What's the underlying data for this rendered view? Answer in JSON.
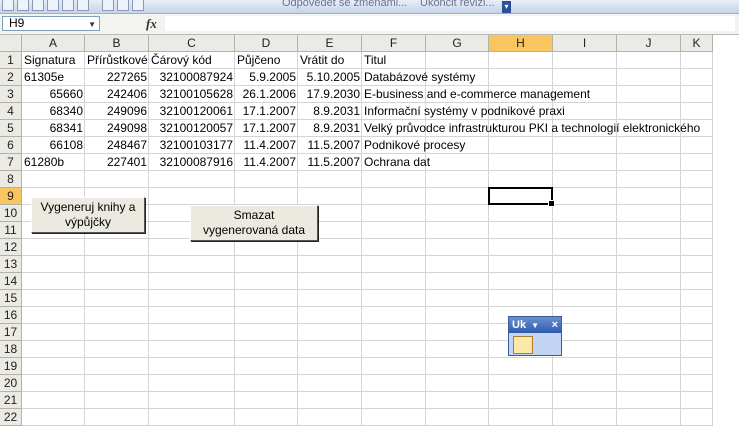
{
  "toolbar": {
    "reply_changes": "Odpovědět se změnami...",
    "end_review": "Ukončit revizi..."
  },
  "formula_bar": {
    "name_box": "H9",
    "fx": "fx",
    "formula": ""
  },
  "columns": [
    "A",
    "B",
    "C",
    "D",
    "E",
    "F",
    "G",
    "H",
    "I",
    "J",
    "K"
  ],
  "rows": [
    "1",
    "2",
    "3",
    "4",
    "5",
    "6",
    "7",
    "8",
    "9",
    "10",
    "11",
    "12",
    "13",
    "14",
    "15",
    "16",
    "17",
    "18",
    "19",
    "20",
    "21",
    "22"
  ],
  "selected_cell": {
    "column": "H",
    "row": "9"
  },
  "table": {
    "headers": [
      "Signatura",
      "Přírůstkové",
      "Čárový kód",
      "Půjčeno",
      "Vrátit do",
      "Titul"
    ],
    "rows": [
      [
        "61305e",
        "227265",
        "32100087924",
        "5.9.2005",
        "5.10.2005",
        "Databázové systémy"
      ],
      [
        "65660",
        "242406",
        "32100105628",
        "26.1.2006",
        "17.9.2030",
        "E-business and e-commerce management"
      ],
      [
        "68340",
        "249096",
        "32100120061",
        "17.1.2007",
        "8.9.2031",
        "Informační systémy v podnikové praxi"
      ],
      [
        "68341",
        "249098",
        "32100120057",
        "17.1.2007",
        "8.9.2031",
        "Velký průvodce infrastrukturou PKI a technologií elektronického"
      ],
      [
        "66108",
        "248467",
        "32100103177",
        "11.4.2007",
        "11.5.2007",
        "Podnikové procesy"
      ],
      [
        "61280b",
        "227401",
        "32100087916",
        "11.4.2007",
        "11.5.2007",
        "Ochrana dat"
      ]
    ]
  },
  "buttons": {
    "generate": "Vygeneruj knihy a výpůjčky",
    "delete": "Smazat vygenerovaná data"
  },
  "floating_toolbar": {
    "title": "Uk",
    "dropdown": "▼",
    "close": "×"
  }
}
